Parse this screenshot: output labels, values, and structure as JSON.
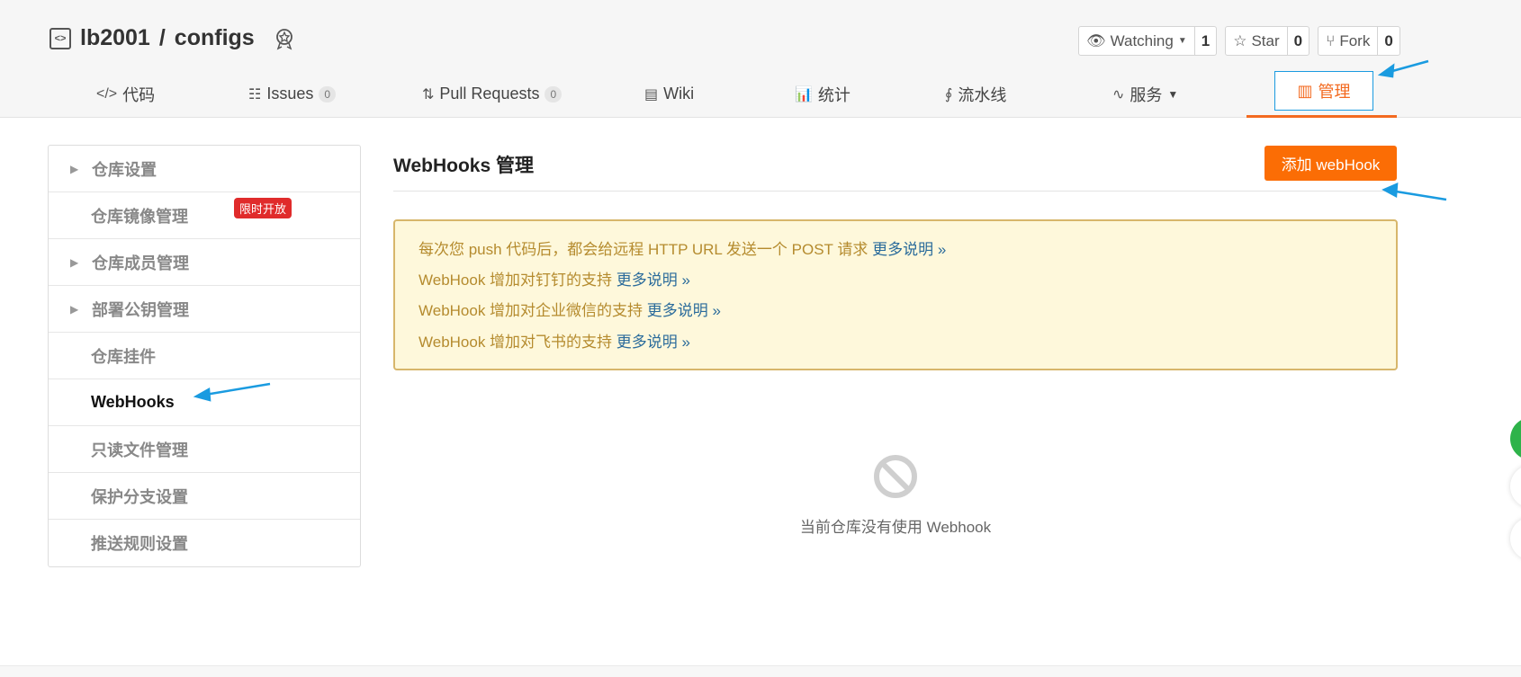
{
  "repo": {
    "owner": "lb2001",
    "separator": "/",
    "name": "configs",
    "actions": [
      {
        "label": "Watching",
        "count": "1"
      },
      {
        "label": "Star",
        "count": "0"
      },
      {
        "label": "Fork",
        "count": "0"
      }
    ]
  },
  "tabs": {
    "code": "代码",
    "issues": "Issues",
    "issues_count": "0",
    "pulls": "Pull Requests",
    "pulls_count": "0",
    "wiki": "Wiki",
    "stats": "统计",
    "pipeline": "流水线",
    "services": "服务",
    "manage": "管理"
  },
  "sidebar": {
    "items": [
      {
        "label": "仓库设置"
      },
      {
        "label": "仓库镜像管理",
        "badge": "限时开放"
      },
      {
        "label": "仓库成员管理"
      },
      {
        "label": "部署公钥管理"
      },
      {
        "label": "仓库挂件"
      },
      {
        "label": "WebHooks"
      },
      {
        "label": "只读文件管理"
      },
      {
        "label": "保护分支设置"
      },
      {
        "label": "推送规则设置"
      }
    ]
  },
  "main": {
    "title": "WebHooks 管理",
    "add_button": "添加 webHook",
    "notice": [
      {
        "text": "每次您 push 代码后，都会给远程 HTTP URL 发送一个 POST 请求 ",
        "link": "更多说明 »"
      },
      {
        "text": "WebHook 增加对钉钉的支持 ",
        "link": "更多说明 »"
      },
      {
        "text": "WebHook 增加对企业微信的支持 ",
        "link": "更多说明 »"
      },
      {
        "text": "WebHook 增加对飞书的支持 ",
        "link": "更多说明 »"
      }
    ],
    "empty_text": "当前仓库没有使用 Webhook"
  },
  "colors": {
    "accent": "#f36a20",
    "button": "#fb6d05",
    "annotation_arrow": "#1a9be0",
    "notice_bg": "#fef8db"
  }
}
